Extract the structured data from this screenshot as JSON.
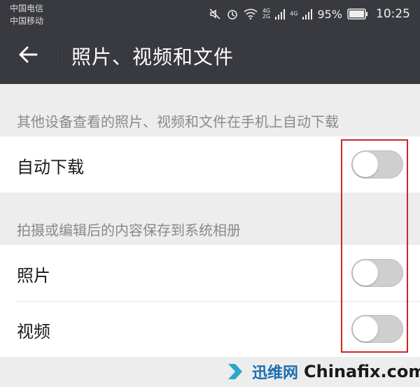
{
  "status_bar": {
    "carrier_1": "中国电信",
    "carrier_2": "中国移动",
    "net_1": "4G",
    "net_2": "2G",
    "net_3": "4G",
    "battery": "95%",
    "time": "10:25"
  },
  "header": {
    "title": "照片、视频和文件"
  },
  "section_1": {
    "caption": "其他设备查看的照片、视频和文件在手机上自动下载",
    "items": [
      {
        "label": "自动下载",
        "enabled": false
      }
    ]
  },
  "section_2": {
    "caption": "拍摄或编辑后的内容保存到系统相册",
    "items": [
      {
        "label": "照片",
        "enabled": false
      },
      {
        "label": "视频",
        "enabled": false
      }
    ]
  },
  "colors": {
    "header_bg": "#393a3f",
    "page_bg": "#ededed",
    "highlight": "#c9282b",
    "switch_off": "#cfcfcf"
  },
  "watermark": {
    "brand_cn": "迅维网",
    "brand_en": "Chinafix.com"
  }
}
